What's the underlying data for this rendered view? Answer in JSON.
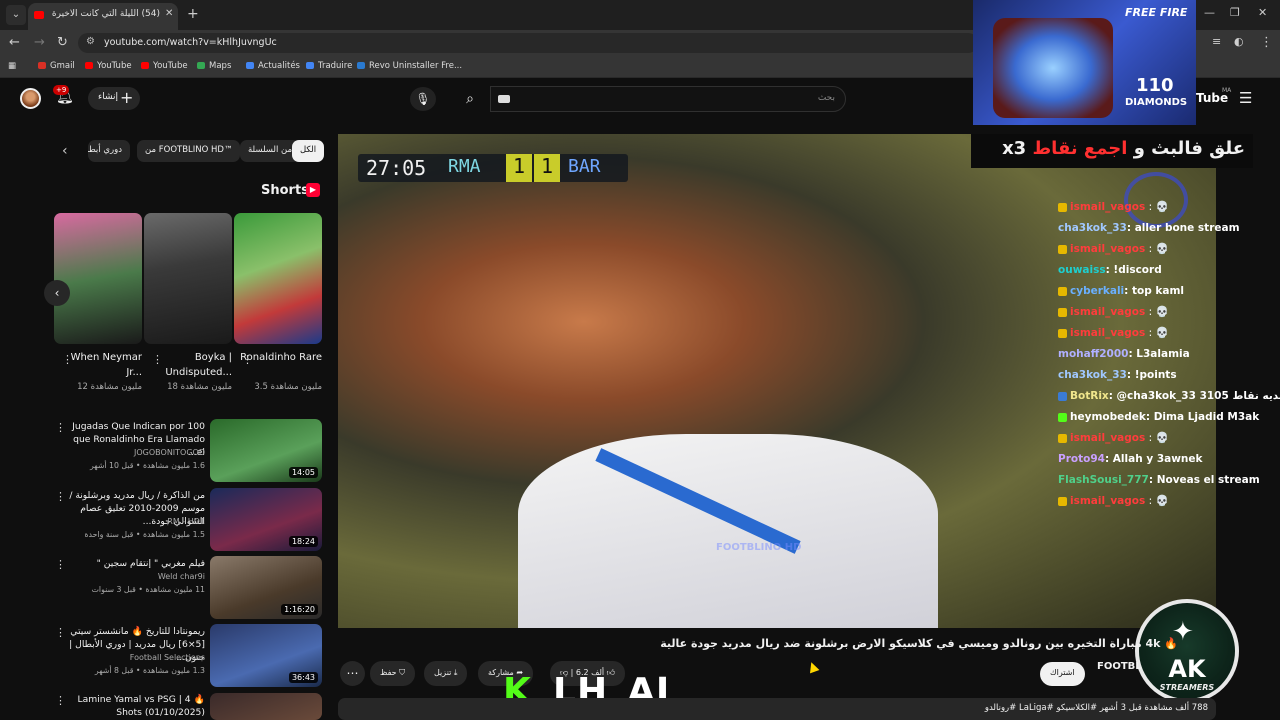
{
  "browser": {
    "tab_title": "(54) الليلة التي كانت الاخيرة",
    "new_tab": "+",
    "url": "youtube.com/watch?v=kHlhJuvngUc",
    "bookmarks": [
      {
        "label": "Gmail",
        "color": "#d93025"
      },
      {
        "label": "YouTube",
        "color": "#ff0000"
      },
      {
        "label": "YouTube",
        "color": "#ff0000"
      },
      {
        "label": "Maps",
        "color": "#34a853"
      },
      {
        "label": "Actualités",
        "color": "#4285f4"
      },
      {
        "label": "Traduire",
        "color": "#4285f4"
      },
      {
        "label": "Revo Uninstaller Fre...",
        "color": "#2a7ad0"
      }
    ]
  },
  "masthead": {
    "notification_count": "+9",
    "create_label": "إنشاء",
    "search_placeholder": "بحث",
    "logo_text": "Tube",
    "logo_region": "MA"
  },
  "chips": [
    "الكل",
    "من السلسلة",
    "من FOOTBLINO HD™",
    "دوري أبطا"
  ],
  "shorts": {
    "title": "Shorts",
    "items": [
      {
        "title": "Ronaldinho Rare",
        "views": "3.5 مليون مشاهدة"
      },
      {
        "title": "Boyka | Undisputed...",
        "views": "18 مليون مشاهدة"
      },
      {
        "title": "When Neymar Jr...",
        "views": "12 مليون مشاهدة"
      }
    ]
  },
  "recommendations": [
    {
      "title": "100 Jugadas Que Indican por que Ronaldinho Era Llamado el...",
      "channel": "JOGOBONITOGOD",
      "meta": "1.6 مليون مشاهدة • قبل 10 أشهر",
      "duration": "14:05"
    },
    {
      "title": "من الذاكرة / ريال مدريد وبرشلونة / موسم 2009-2010 تعليق عصام الشوالي جودة...",
      "channel": "RM - HD1",
      "meta": "1.5 مليون مشاهدة • قبل سنة واحدة",
      "duration": "18:24"
    },
    {
      "title": "فيلم مغربي \" إنتقام سجين \"",
      "channel": "Weld char9i",
      "meta": "11 مليون مشاهدة • قبل 3 سنوات",
      "duration": "1:16:20"
    },
    {
      "title": "ريمونتادا للتاريخ 🔥 مانشستر سيتي [5×6] ريال مدريد | دوري الأبطال | جنون...",
      "channel": "Football Selections",
      "meta": "1.3 مليون مشاهدة • قبل 8 أشهر",
      "duration": "36:43"
    },
    {
      "title": "🔥 Lamine Yamal vs PSG | 4 Shots (01/10/2025)",
      "channel": "",
      "meta": "",
      "duration": ""
    }
  ],
  "player": {
    "time": "27:05",
    "home": "RMA",
    "home_score": "1",
    "away_score": "1",
    "away": "BAR",
    "watermark": "FOOTBLINO HD"
  },
  "overlay": {
    "ad_brand": "FREE FIRE",
    "ad_amount": "110",
    "ad_unit": "DIAMONDS",
    "promo_prefix": "علق فالبث و ",
    "promo_red": "اجمع نقاط",
    "promo_suffix": " x3",
    "ak_text": "AK",
    "ak_sub": "STREAMERS",
    "kick_letter": "K",
    "streamer": "LH_AJ"
  },
  "chat": [
    {
      "user": "ismail_vagos",
      "msg": "",
      "color": "#ff3c3c",
      "badge": "#e6b800",
      "emote": true
    },
    {
      "user": "cha3kok_33",
      "msg": ": aller bone stream",
      "color": "#a0c8ff",
      "badge": "",
      "emote": false
    },
    {
      "user": "ismail_vagos",
      "msg": "",
      "color": "#ff3c3c",
      "badge": "#e6b800",
      "emote": true
    },
    {
      "user": "ouwaiss",
      "msg": ": !discord",
      "color": "#1ecfcf",
      "badge": "",
      "emote": false
    },
    {
      "user": "cyberkali",
      "msg": ": top kaml",
      "color": "#6ab0ff",
      "badge": "#e6b800",
      "emote": false
    },
    {
      "user": "ismail_vagos",
      "msg": "",
      "color": "#ff3c3c",
      "badge": "#e6b800",
      "emote": true
    },
    {
      "user": "ismail_vagos",
      "msg": "",
      "color": "#ff3c3c",
      "badge": "#e6b800",
      "emote": true
    },
    {
      "user": "mohaff2000",
      "msg": ": L3alamia",
      "color": "#b0b0ff",
      "badge": "",
      "emote": false
    },
    {
      "user": "cha3kok_33",
      "msg": ": !points",
      "color": "#a0c8ff",
      "badge": "",
      "emote": false
    },
    {
      "user": "BotRix",
      "msg": ": @cha3kok_33 3105 لديه نقاط",
      "color": "#f0e68c",
      "badge": "#3a7bd5",
      "emote": false
    },
    {
      "user": "heymobedek",
      "msg": ": Dima Ljadid M3ak",
      "color": "#ffffff",
      "badge": "#53fc18",
      "emote": false
    },
    {
      "user": "ismail_vagos",
      "msg": "",
      "color": "#ff3c3c",
      "badge": "#e6b800",
      "emote": true
    },
    {
      "user": "Proto94",
      "msg": ": Allah y 3awnek",
      "color": "#c9a0ff",
      "badge": "",
      "emote": false
    },
    {
      "user": "FlashSousi_777",
      "msg": ": Noveas el stream",
      "color": "#4fd08a",
      "badge": "",
      "emote": false
    },
    {
      "user": "ismail_vagos",
      "msg": "",
      "color": "#ff3c3c",
      "badge": "#e6b800",
      "emote": true
    }
  ],
  "video": {
    "title": "🔥 4k مباراة التخيره بين رونالدو وميسي في كلاسيكو الارض برشلونة ضد ريال مدريد جودة عالية",
    "channel": "FOOTBL",
    "subscribe": "اشتراك",
    "likes": "6.2 ألف",
    "share": "مشاركة",
    "download": "تنزيل",
    "save": "حفظ",
    "description": "788 ألف مشاهدة قبل 3 أشهر #الكلاسيكو #LaLiga #رونالدو"
  }
}
